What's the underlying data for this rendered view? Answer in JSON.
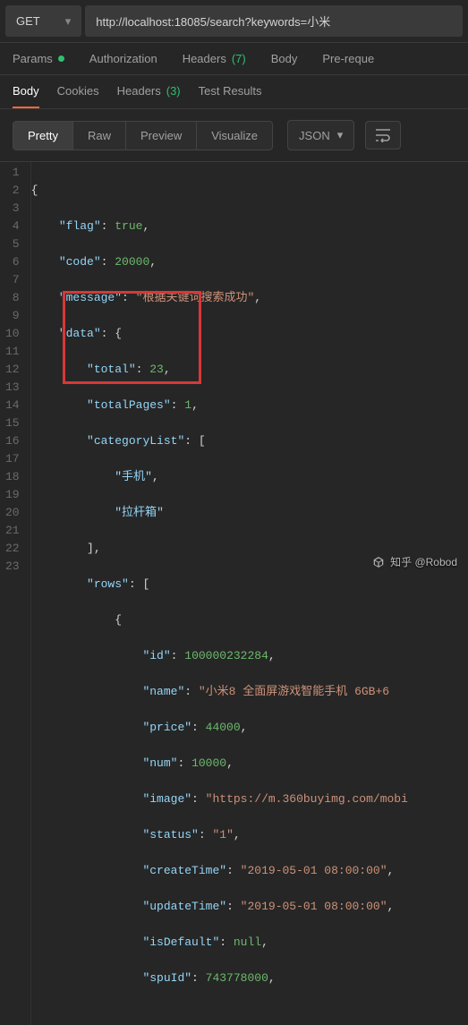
{
  "method": "GET",
  "url": "http://localhost:18085/search?keywords=小米",
  "reqTabs": {
    "params": "Params",
    "authorization": "Authorization",
    "headersLabel": "Headers",
    "headersCount": "(7)",
    "body": "Body",
    "prerequest": "Pre-reque"
  },
  "respTabs": {
    "body": "Body",
    "cookies": "Cookies",
    "headersLabel": "Headers",
    "headersCount": "(3)",
    "testresults": "Test Results"
  },
  "viewTabs": {
    "pretty": "Pretty",
    "raw": "Raw",
    "preview": "Preview",
    "visualize": "Visualize"
  },
  "langSelect": "JSON",
  "json": {
    "flag": "true",
    "code": "20000",
    "message": "根据关键词搜索成功",
    "data": {
      "total": "23",
      "totalPages": "1",
      "categoryList": [
        "手机",
        "拉杆箱"
      ],
      "rows": [
        {
          "id": "100000232284",
          "name": "小米8 全面屏游戏智能手机 6GB+6",
          "price": "44000",
          "num": "10000",
          "image": "https://m.360buyimg.com/mobi",
          "status": "1",
          "createTime": "2019-05-01 08:00:00",
          "updateTime": "2019-05-01 08:00:00",
          "isDefault": "null",
          "spuId": "743778000"
        }
      ]
    }
  },
  "watermark": "知乎 @Robod",
  "lineNumbers": [
    "1",
    "2",
    "3",
    "4",
    "5",
    "6",
    "7",
    "8",
    "9",
    "10",
    "11",
    "12",
    "13",
    "14",
    "15",
    "16",
    "17",
    "18",
    "19",
    "20",
    "21",
    "22",
    "23"
  ]
}
